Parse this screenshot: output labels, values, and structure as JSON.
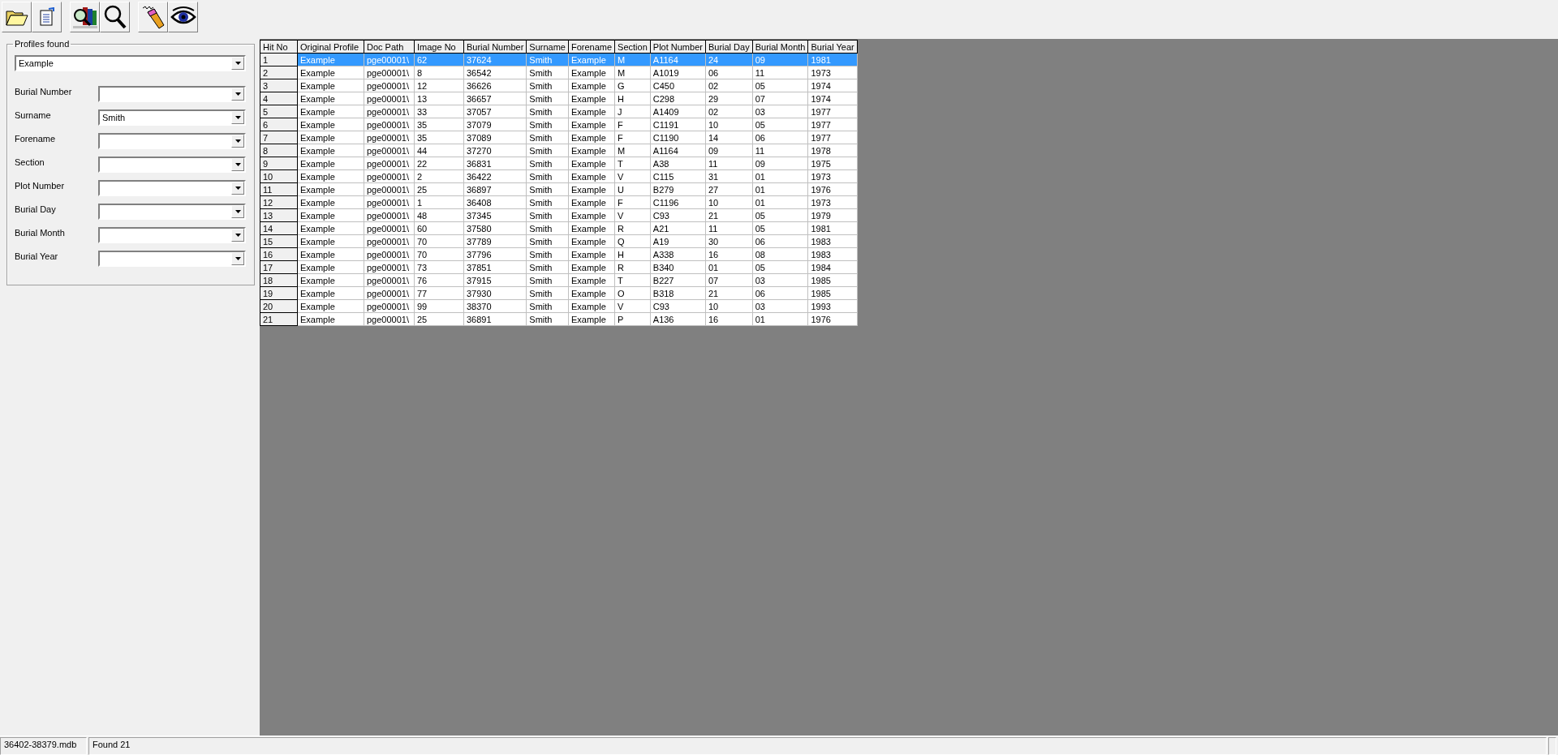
{
  "toolbar": [
    {
      "kind": "folder"
    },
    {
      "kind": "document"
    },
    {
      "kind": "books"
    },
    {
      "kind": "magnifier"
    },
    {
      "kind": "pencil"
    },
    {
      "kind": "eye"
    }
  ],
  "profiles": {
    "title": "Profiles found",
    "value": "Example"
  },
  "filters": [
    {
      "label": "Burial Number"
    },
    {
      "label": "Surname",
      "value": "Smith"
    },
    {
      "label": "Forename"
    },
    {
      "label": "Section"
    },
    {
      "label": "Plot Number"
    },
    {
      "label": "Burial Day"
    },
    {
      "label": "Burial Month"
    },
    {
      "label": "Burial Year"
    }
  ],
  "table": {
    "columns": [
      "Hit No",
      "Original Profile",
      "Doc Path",
      "Image No",
      "Burial Number",
      "Surname",
      "Forename",
      "Section",
      "Plot Number",
      "Burial Day",
      "Burial Month",
      "Burial Year"
    ],
    "rows": [
      {
        "selected": true,
        "cells": [
          "1",
          "Example",
          "pge00001\\",
          "62",
          "37624",
          "Smith",
          "Example",
          "M",
          "A1164",
          "24",
          "09",
          "1981"
        ]
      },
      {
        "selected": false,
        "cells": [
          "2",
          "Example",
          "pge00001\\",
          "8",
          "36542",
          "Smith",
          "Example",
          "M",
          "A1019",
          "06",
          "11",
          "1973"
        ]
      },
      {
        "selected": false,
        "cells": [
          "3",
          "Example",
          "pge00001\\",
          "12",
          "36626",
          "Smith",
          "Example",
          "G",
          "C450",
          "02",
          "05",
          "1974"
        ]
      },
      {
        "selected": false,
        "cells": [
          "4",
          "Example",
          "pge00001\\",
          "13",
          "36657",
          "Smith",
          "Example",
          "H",
          "C298",
          "29",
          "07",
          "1974"
        ]
      },
      {
        "selected": false,
        "cells": [
          "5",
          "Example",
          "pge00001\\",
          "33",
          "37057",
          "Smith",
          "Example",
          "J",
          "A1409",
          "02",
          "03",
          "1977"
        ]
      },
      {
        "selected": false,
        "cells": [
          "6",
          "Example",
          "pge00001\\",
          "35",
          "37079",
          "Smith",
          "Example",
          "F",
          "C1191",
          "10",
          "05",
          "1977"
        ]
      },
      {
        "selected": false,
        "cells": [
          "7",
          "Example",
          "pge00001\\",
          "35",
          "37089",
          "Smith",
          "Example",
          "F",
          "C1190",
          "14",
          "06",
          "1977"
        ]
      },
      {
        "selected": false,
        "cells": [
          "8",
          "Example",
          "pge00001\\",
          "44",
          "37270",
          "Smith",
          "Example",
          "M",
          "A1164",
          "09",
          "11",
          "1978"
        ]
      },
      {
        "selected": false,
        "cells": [
          "9",
          "Example",
          "pge00001\\",
          "22",
          "36831",
          "Smith",
          "Example",
          "T",
          "A38",
          "11",
          "09",
          "1975"
        ]
      },
      {
        "selected": false,
        "cells": [
          "10",
          "Example",
          "pge00001\\",
          "2",
          "36422",
          "Smith",
          "Example",
          "V",
          "C115",
          "31",
          "01",
          "1973"
        ]
      },
      {
        "selected": false,
        "cells": [
          "11",
          "Example",
          "pge00001\\",
          "25",
          "36897",
          "Smith",
          "Example",
          "U",
          "B279",
          "27",
          "01",
          "1976"
        ]
      },
      {
        "selected": false,
        "cells": [
          "12",
          "Example",
          "pge00001\\",
          "1",
          "36408",
          "Smith",
          "Example",
          "F",
          "C1196",
          "10",
          "01",
          "1973"
        ]
      },
      {
        "selected": false,
        "cells": [
          "13",
          "Example",
          "pge00001\\",
          "48",
          "37345",
          "Smith",
          "Example",
          "V",
          "C93",
          "21",
          "05",
          "1979"
        ]
      },
      {
        "selected": false,
        "cells": [
          "14",
          "Example",
          "pge00001\\",
          "60",
          "37580",
          "Smith",
          "Example",
          "R",
          "A21",
          "11",
          "05",
          "1981"
        ]
      },
      {
        "selected": false,
        "cells": [
          "15",
          "Example",
          "pge00001\\",
          "70",
          "37789",
          "Smith",
          "Example",
          "Q",
          "A19",
          "30",
          "06",
          "1983"
        ]
      },
      {
        "selected": false,
        "cells": [
          "16",
          "Example",
          "pge00001\\",
          "70",
          "37796",
          "Smith",
          "Example",
          "H",
          "A338",
          "16",
          "08",
          "1983"
        ]
      },
      {
        "selected": false,
        "cells": [
          "17",
          "Example",
          "pge00001\\",
          "73",
          "37851",
          "Smith",
          "Example",
          "R",
          "B340",
          "01",
          "05",
          "1984"
        ]
      },
      {
        "selected": false,
        "cells": [
          "18",
          "Example",
          "pge00001\\",
          "76",
          "37915",
          "Smith",
          "Example",
          "T",
          "B227",
          "07",
          "03",
          "1985"
        ]
      },
      {
        "selected": false,
        "cells": [
          "19",
          "Example",
          "pge00001\\",
          "77",
          "37930",
          "Smith",
          "Example",
          "O",
          "B318",
          "21",
          "06",
          "1985"
        ]
      },
      {
        "selected": false,
        "cells": [
          "20",
          "Example",
          "pge00001\\",
          "99",
          "38370",
          "Smith",
          "Example",
          "V",
          "C93",
          "10",
          "03",
          "1993"
        ]
      },
      {
        "selected": false,
        "cells": [
          "21",
          "Example",
          "pge00001\\",
          "25",
          "36891",
          "Smith",
          "Example",
          "P",
          "A136",
          "16",
          "01",
          "1976"
        ]
      }
    ]
  },
  "status_bar": [
    "36402-38379.mdb",
    "Found 21"
  ]
}
